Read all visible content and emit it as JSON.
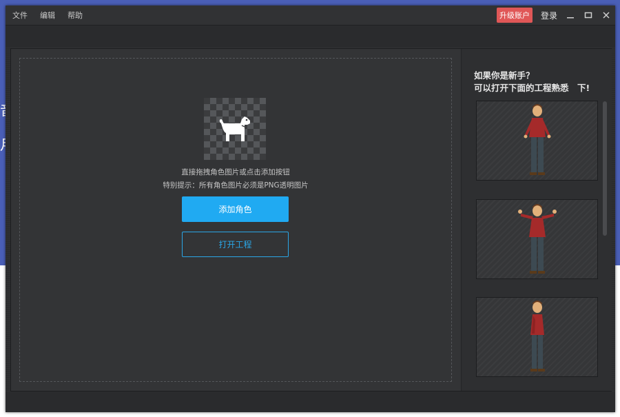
{
  "menu": {
    "file": "文件",
    "edit": "编辑",
    "help": "帮助"
  },
  "titlebar": {
    "upgrade_label": "升级账户",
    "login_label": "登录"
  },
  "dropzone": {
    "hint_line1": "直接拖拽角色图片或点击添加按钮",
    "hint_line2": "特别提示：所有角色图片必须是PNG透明图片",
    "add_button": "添加角色",
    "open_button": "打开工程"
  },
  "sidebar": {
    "title_line1": "如果你是新手？",
    "title_line2": "可以打开下面的工程熟悉　下!",
    "samples": [
      "sample-1",
      "sample-2",
      "sample-3"
    ]
  },
  "colors": {
    "accent": "#20aaf2",
    "upgrade": "#e05757",
    "panel": "#333436"
  }
}
